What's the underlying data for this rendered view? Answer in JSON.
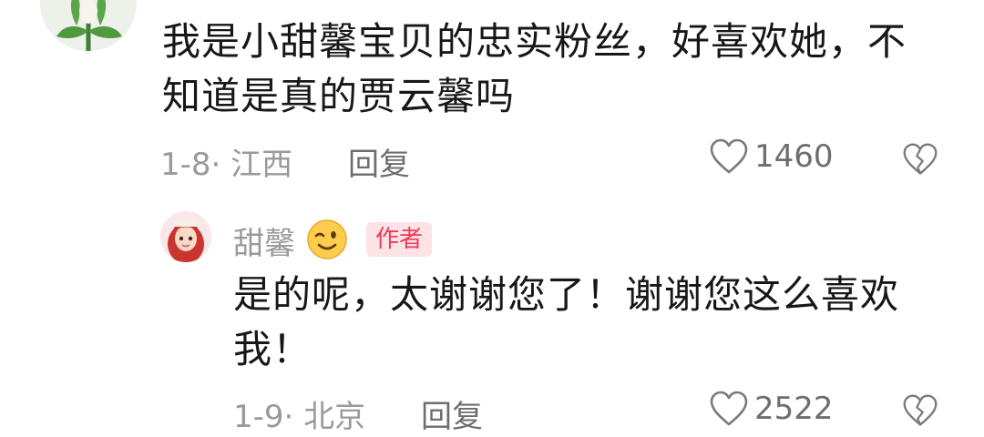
{
  "comment": {
    "text": "我是小甜馨宝贝的忠实粉丝，好喜欢她，不知道是真的贾云馨吗",
    "date_location": "1-8· 江西",
    "reply_label": "回复",
    "like_count": "1460",
    "avatar_icon": "tulip-flower-avatar",
    "icons": {
      "like": "heart-outline-icon",
      "dislike": "broken-heart-icon"
    }
  },
  "reply": {
    "username": "甜馨",
    "emoji": "winking-face-emoji",
    "badge": "作者",
    "text": "是的呢，太谢谢您了！谢谢您这么喜欢我！",
    "date_location": "1-9· 北京",
    "reply_label": "回复",
    "like_count": "2522",
    "avatar_icon": "cartoon-girl-avatar",
    "icons": {
      "like": "heart-outline-icon",
      "dislike": "broken-heart-icon"
    }
  },
  "colors": {
    "badge_text": "#f03a55",
    "badge_bg": "#fde3e6",
    "meta_text": "#9a9a9a",
    "action_text": "#6e6e6e"
  }
}
